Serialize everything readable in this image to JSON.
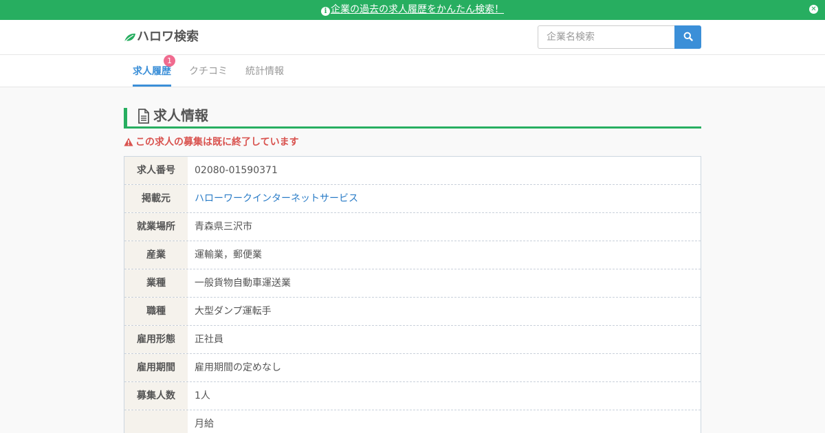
{
  "banner": {
    "text": "企業の過去の求人履歴をかんたん検索！",
    "info_icon": "info-circle-icon",
    "close_icon": "times-circle-icon"
  },
  "header": {
    "logo_text": "ハロワ検索",
    "logo_icon": "leaf-icon",
    "search_placeholder": "企業名検索",
    "search_icon": "search-icon"
  },
  "tabs": [
    {
      "label": "求人履歴",
      "active": true,
      "badge": "1"
    },
    {
      "label": "クチコミ",
      "active": false
    },
    {
      "label": "統計情報",
      "active": false
    }
  ],
  "section": {
    "title": "求人情報",
    "icon": "file-text-icon"
  },
  "warning": {
    "text": "この求人の募集は既に終了しています",
    "icon": "warning-triangle-icon"
  },
  "rows": [
    {
      "label": "求人番号",
      "value": "02080-01590371"
    },
    {
      "label": "掲載元",
      "value": "ハローワークインターネットサービス"
    },
    {
      "label": "就業場所",
      "value": "青森県三沢市"
    },
    {
      "label": "産業",
      "value": "運輸業，郵便業"
    },
    {
      "label": "業種",
      "value": "一般貨物自動車運送業"
    },
    {
      "label": "職種",
      "value": "大型ダンプ運転手"
    },
    {
      "label": "雇用形態",
      "value": "正社員"
    },
    {
      "label": "雇用期間",
      "value": "雇用期間の定めなし"
    },
    {
      "label": "募集人数",
      "value": "1人"
    },
    {
      "label": "",
      "value": "月給"
    }
  ],
  "colors": {
    "brand_green": "#27ae60",
    "accent_blue": "#3b8fd8",
    "warning_red": "#d9534f",
    "badge_pink": "#f06b8f"
  }
}
